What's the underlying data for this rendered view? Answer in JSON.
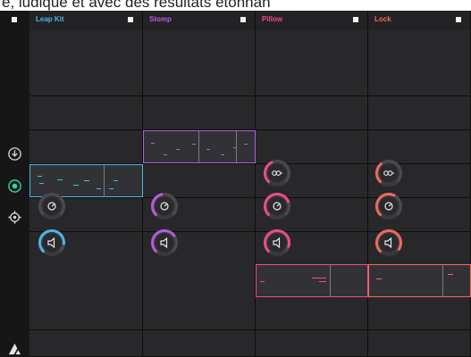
{
  "caption": {
    "text": "e, ludique et avec des résultats étonnan"
  },
  "sidebar": {
    "icons": [
      "square-stop-icon",
      "download-icon",
      "record-icon",
      "settings-icon",
      "logo-icon"
    ],
    "active_color": "#2fd6a4"
  },
  "tracks": [
    {
      "name": "Leap Kit",
      "color": "#4ab6e6",
      "clip": {
        "color": "#4ab6e6"
      },
      "knobs": [
        {
          "icon": "pan-icon",
          "level": 0.0,
          "active": false
        },
        {
          "icon": "volume-icon",
          "level": 0.85,
          "active": true
        }
      ]
    },
    {
      "name": "Stomp",
      "color": "#b55ae0",
      "clip": {
        "color": "#b55ae0"
      },
      "knobs": [
        {
          "icon": "pan-icon",
          "level": 0.45,
          "active": true
        },
        {
          "icon": "volume-icon",
          "level": 0.7,
          "active": true
        }
      ]
    },
    {
      "name": "Pillow",
      "color": "#f04a8a",
      "clip": {
        "color": "#f04a8a"
      },
      "knobs": [
        {
          "icon": "send-icon",
          "level": 0.4,
          "active": true
        },
        {
          "icon": "pan-icon",
          "level": 0.75,
          "active": true
        },
        {
          "icon": "volume-icon",
          "level": 0.9,
          "active": true
        }
      ]
    },
    {
      "name": "Lock",
      "color": "#f2685a",
      "clip": {
        "color": "#f2685a"
      },
      "knobs": [
        {
          "icon": "send-icon",
          "level": 0.35,
          "active": true
        },
        {
          "icon": "pan-icon",
          "level": 0.6,
          "active": true
        },
        {
          "icon": "volume-icon",
          "level": 0.95,
          "active": true
        }
      ]
    }
  ]
}
